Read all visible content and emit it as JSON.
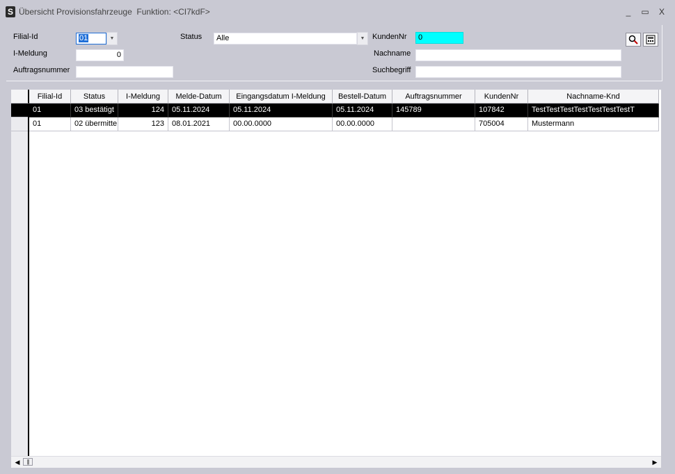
{
  "window": {
    "title": "Übersicht Provisionsfahrzeuge  Funktion: <CI7kdF>",
    "app_icon": "S",
    "minimize": "_",
    "maximize": "▭",
    "close": "X"
  },
  "filters": {
    "filial_label": "Filial-Id",
    "filial_value": "01",
    "status_label": "Status",
    "status_value": "Alle",
    "kundennr_label": "KundenNr",
    "kundennr_value": "0",
    "imeldung_label": "I-Meldung",
    "imeldung_value": "0",
    "nachname_label": "Nachname",
    "nachname_value": "",
    "auftragsnummer_label": "Auftragsnummer",
    "auftragsnummer_value": "",
    "suchbegriff_label": "Suchbegriff",
    "suchbegriff_value": "",
    "dropdown_glyph": "▼",
    "accent_cyan": "#00ffff",
    "selected_blue": "#1f6fd8"
  },
  "toolbar": {
    "search_icon": "search-magnifier-icon",
    "calc_icon": "calculator-icon"
  },
  "grid": {
    "columns": [
      "Filial-Id",
      "Status",
      "I-Meldung",
      "Melde-Datum",
      "Eingangsdatum I-Meldung",
      "Bestell-Datum",
      "Auftragsnummer",
      "KundenNr",
      "Nachname-Knd"
    ],
    "rows": [
      [
        "01",
        "03 bestätigt",
        "124",
        "05.11.2024",
        "05.11.2024",
        "05.11.2024",
        "145789",
        "107842",
        "TestTestTestTestTestTestTestT"
      ],
      [
        "01",
        "02 übermitte",
        "123",
        "08.01.2021",
        "00.00.0000",
        "00.00.0000",
        "",
        "705004",
        "Mustermann"
      ]
    ],
    "selected_row": 0
  },
  "scrollbar": {
    "left_arrow": "◀",
    "right_arrow": "▶",
    "thumb_grip": "|||"
  }
}
